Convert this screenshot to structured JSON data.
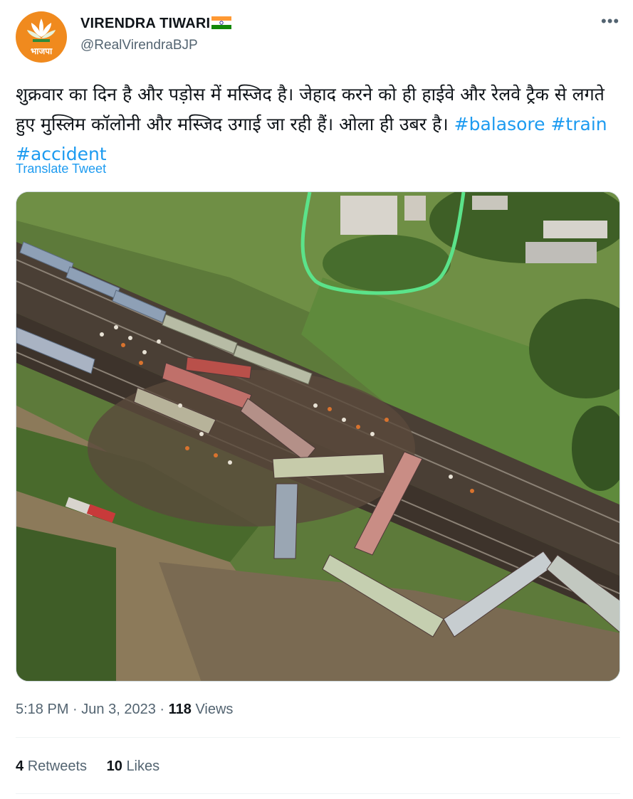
{
  "author": {
    "name": "VIRENDRA TIWARI",
    "handle": "@RealVirendraBJP",
    "avatar_text": "भाजपा",
    "avatar_color": "#f08a1e"
  },
  "tweet": {
    "text": "शुक्रवार का दिन है और पड़ोस में मस्जिद है। जेहाद करने को ही हाईवे और रेलवे ट्रैक से लगते हुए मुस्लिम कॉलोनी और मस्जिद उगाई जा रही हैं। ओला ही उबर है।",
    "hashtags": [
      "#balasore",
      "#train",
      "#accident"
    ],
    "translate_label": "Translate Tweet"
  },
  "meta": {
    "time": "5:18 PM",
    "separator": "·",
    "date": "Jun 3, 2023",
    "views_count": "118",
    "views_label": "Views"
  },
  "stats": {
    "retweets_count": "4",
    "retweets_label": "Retweets",
    "likes_count": "10",
    "likes_label": "Likes"
  },
  "colors": {
    "link": "#1d9bf0",
    "secondary_text": "#536471",
    "highlight_circle": "#5be38a"
  }
}
